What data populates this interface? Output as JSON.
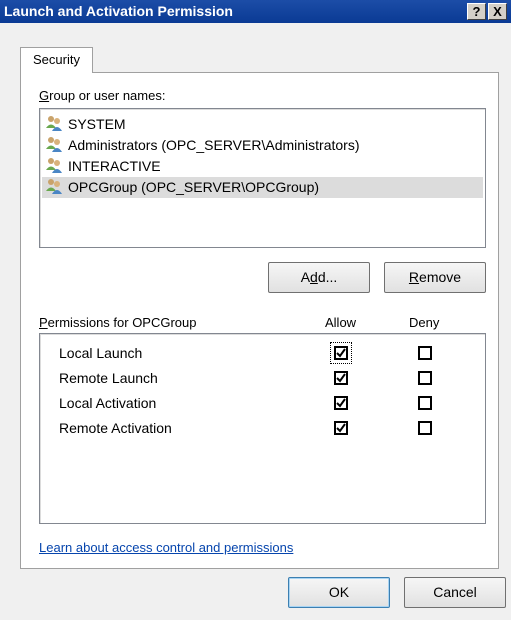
{
  "window": {
    "title": "Launch and Activation Permission",
    "help_button": "?",
    "close_button": "X"
  },
  "tabs": [
    {
      "label": "Security",
      "selected": true
    }
  ],
  "group_section": {
    "label_prefix": "",
    "label_mnemonic": "G",
    "label_rest": "roup or user names:",
    "users": [
      {
        "name": "SYSTEM",
        "icon": "user-group-icon",
        "selected": false
      },
      {
        "name": "Administrators (OPC_SERVER\\Administrators)",
        "icon": "user-group-icon",
        "selected": false
      },
      {
        "name": "INTERACTIVE",
        "icon": "user-group-icon",
        "selected": false
      },
      {
        "name": "OPCGroup (OPC_SERVER\\OPCGroup)",
        "icon": "user-group-icon",
        "selected": true
      }
    ]
  },
  "buttons": {
    "add_pre": "A",
    "add_mnemonic": "d",
    "add_post": "d...",
    "remove_mnemonic": "R",
    "remove_post": "emove",
    "ok": "OK",
    "cancel": "Cancel"
  },
  "permissions": {
    "header_mnemonic": "P",
    "header_rest": "ermissions for OPCGroup",
    "allow_header": "Allow",
    "deny_header": "Deny",
    "rows": [
      {
        "name": "Local Launch",
        "allow": true,
        "deny": false,
        "focused": true
      },
      {
        "name": "Remote Launch",
        "allow": true,
        "deny": false,
        "focused": false
      },
      {
        "name": "Local Activation",
        "allow": true,
        "deny": false,
        "focused": false
      },
      {
        "name": "Remote Activation",
        "allow": true,
        "deny": false,
        "focused": false
      }
    ]
  },
  "link": {
    "text": "Learn about access control and permissions"
  },
  "colors": {
    "titlebar": "#0a3a94",
    "selection": "#dcdcdc",
    "link": "#0645ad"
  }
}
